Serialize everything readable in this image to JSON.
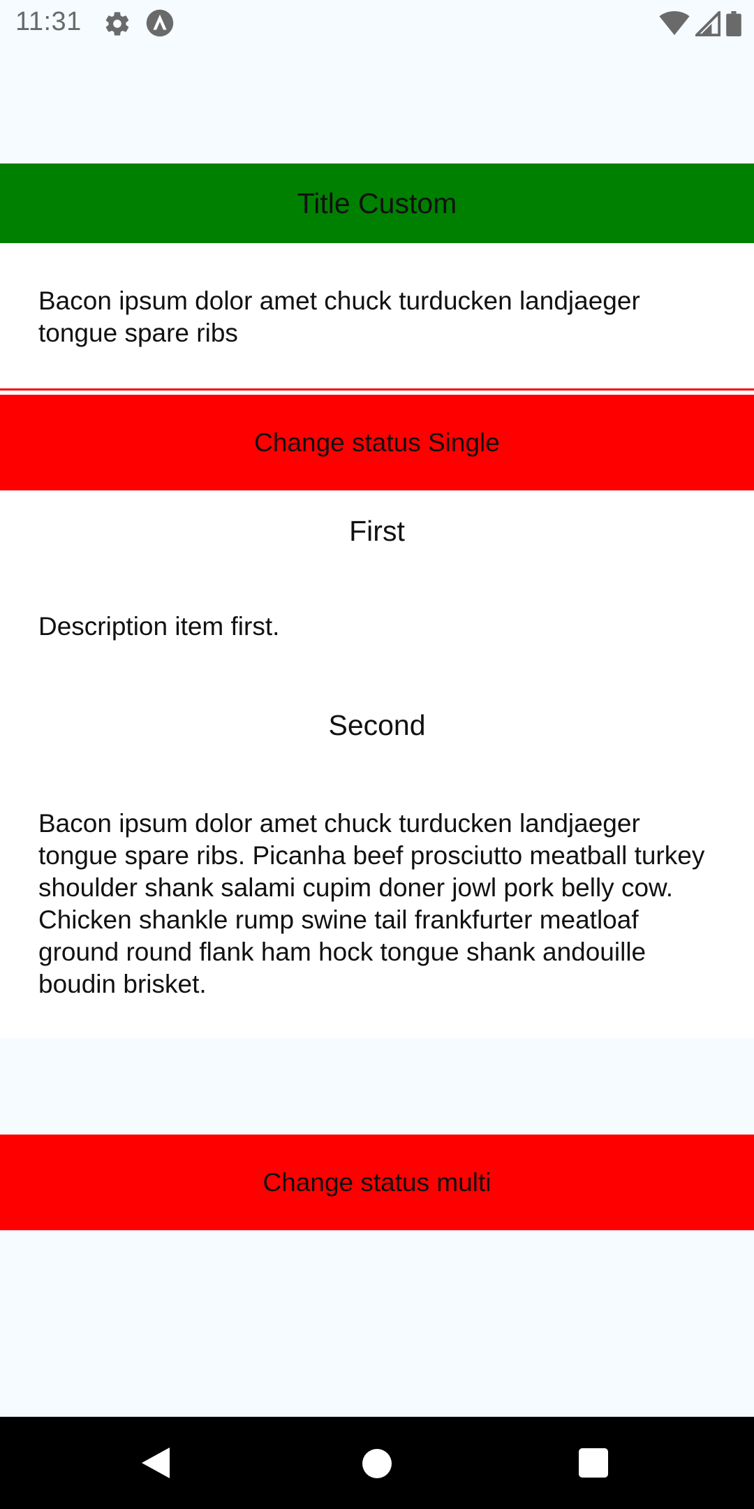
{
  "status_bar": {
    "time": "11:31",
    "icons": [
      "gear-icon",
      "app-a-icon",
      "wifi-icon",
      "signal-icon",
      "battery-icon"
    ]
  },
  "header": {
    "title": "Title Custom",
    "background": "#008000"
  },
  "content": {
    "text": "Bacon ipsum dolor amet chuck turducken landjaeger tongue spare ribs"
  },
  "buttons": {
    "single_label": "Change status Single",
    "multi_label": "Change status multi",
    "color": "#ff0000"
  },
  "accordion": {
    "items": [
      {
        "title": "First",
        "description": "Description item first."
      },
      {
        "title": "Second",
        "description": "Bacon ipsum dolor amet chuck turducken landjaeger tongue spare ribs. Picanha beef prosciutto meatball turkey shoulder shank salami cupim doner jowl pork belly cow. Chicken shankle rump swine tail frankfurter meatloaf ground round flank ham hock tongue shank andouille boudin brisket."
      }
    ]
  },
  "nav_bar": {
    "icons": [
      "back-icon",
      "home-icon",
      "recents-icon"
    ]
  }
}
